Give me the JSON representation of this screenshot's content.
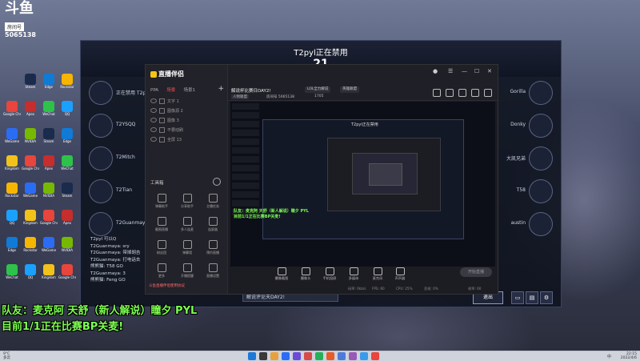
{
  "streamer": {
    "logo": "斗鱼",
    "tag": "房间号",
    "room_number": "5065138"
  },
  "desktop_icons": [
    {
      "label": "Google Chrome",
      "color": "#e8453c"
    },
    {
      "label": "WeGame",
      "color": "#2a6df4"
    },
    {
      "label": "Kingdom",
      "color": "#f2c21b"
    },
    {
      "label": "Rockstar",
      "color": "#f7b500"
    },
    {
      "label": "QQ",
      "color": "#1aa1ff"
    },
    {
      "label": "Edge",
      "color": "#0f7bd6"
    },
    {
      "label": "WeChat",
      "color": "#2ec24b"
    },
    {
      "label": "Steam",
      "color": "#1a2b4c"
    },
    {
      "label": "Apex",
      "color": "#c62d2d"
    },
    {
      "label": "NVIDIA",
      "color": "#76b900"
    }
  ],
  "lobby": {
    "banned_text": "T2pyl正在禁用",
    "banned_timer": "21",
    "left_team": [
      {
        "name": "正在禁用 T2pyl"
      },
      {
        "name": "T2YSQQ"
      },
      {
        "name": "T2Mitch"
      },
      {
        "name": "T2Tian"
      },
      {
        "name": "T2Guanmaya"
      }
    ],
    "right_team": [
      {
        "name": "Gorilla"
      },
      {
        "name": "Donky"
      },
      {
        "name": "大凯兄弟"
      },
      {
        "name": "T58"
      },
      {
        "name": "austin"
      }
    ],
    "chat": [
      "T2pyl 可以Q",
      "T2Guanmaya: sry",
      "T2Guanmaya: 带掉胡吉",
      "T2Guanmaya: 打电话去",
      "熊熊猫: T58 GO",
      "T2Guanmaya: 3",
      "熊熊猫: Feng GO"
    ],
    "input_placeholder": "解说评论天DAY2!",
    "exit_label": "退出"
  },
  "app": {
    "name": "直播伴侣",
    "scene_tabs": [
      "PPA",
      "场景",
      "场景1"
    ],
    "sources": [
      "文字 1",
      "图像源 2",
      "图像 3",
      "不要动刷",
      "全屏 13"
    ],
    "tools_header": "工具箱",
    "tools": [
      "弹幕助手",
      "分享助手",
      "主播任务",
      "截图直播",
      "多人连麦",
      "连屏器",
      "粉丝团",
      "弹幕墙",
      "预约直播",
      "更多",
      "开播提醒",
      "直播设置"
    ],
    "footer_note": "斗鱼直播伴侣使用协议",
    "room_title": "解说杯比赛日DAY2!",
    "category_btn": "LOL全力解说",
    "tag_btn": "英雄联盟",
    "info_type": "人物联盟",
    "info_room": "房间号 5065138",
    "info_level": "1705",
    "preview_title": "T2pyl正在禁用",
    "preview_chat_1": "队友：麦克阿 天舒（新人解说）瞳夕 PYL",
    "preview_chat_2": "目前1/1正在比赛BP关麦!",
    "controls": [
      "摄像截图",
      "摄像头",
      "手机投屏",
      "多媒体",
      "麦克风",
      "声声器"
    ],
    "go_live": "开始直播",
    "status": [
      "码率: 0kb/s",
      "FPS: 60",
      "CPU: 25%",
      "丢帧: 0%",
      "帧率: 60"
    ]
  },
  "overlay": {
    "line1": "队友：麦克阿 天舒（新人解说）瞳夕 PYL",
    "line2": "目前1/1正在比赛BP关麦!"
  },
  "taskbar": {
    "weather_temp": "9°C",
    "weather_desc": "多云",
    "tray_lang": "中",
    "time": "22:15",
    "date": "2022/4/6",
    "icon_colors": [
      "#1e78d8",
      "#3a3a3a",
      "#e8a13c",
      "#2a6df4",
      "#6b4bd8",
      "#d84b4b",
      "#27b05a",
      "#e85b2a",
      "#4f7bd8",
      "#9b59b6",
      "#3c9be8",
      "#e8453c"
    ]
  }
}
